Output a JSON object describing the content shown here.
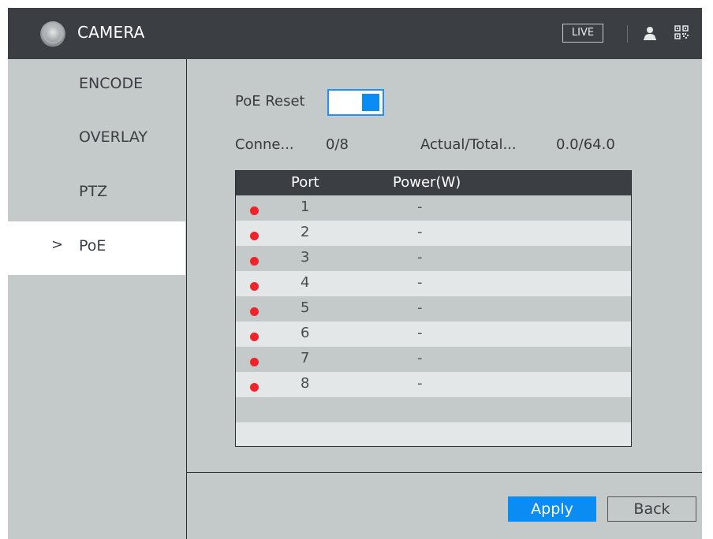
{
  "header": {
    "title": "CAMERA",
    "live_label": "LIVE",
    "icons": [
      "camera-logo-icon",
      "user-icon",
      "qr-code-icon"
    ]
  },
  "sidebar": {
    "items": [
      {
        "label": "ENCODE",
        "active": false
      },
      {
        "label": "OVERLAY",
        "active": false
      },
      {
        "label": "PTZ",
        "active": false
      },
      {
        "label": "PoE",
        "active": true,
        "chevron": ">"
      }
    ]
  },
  "poe": {
    "reset_label": "PoE Reset",
    "reset_enabled": true,
    "connected_label": "Conne...",
    "connected_value": "0/8",
    "actual_total_label": "Actual/Total...",
    "actual_total_value": "0.0/64.0"
  },
  "table": {
    "headers": {
      "port": "Port",
      "power": "Power(W)"
    },
    "rows": [
      {
        "port": "1",
        "power": "-",
        "status": "offline"
      },
      {
        "port": "2",
        "power": "-",
        "status": "offline"
      },
      {
        "port": "3",
        "power": "-",
        "status": "offline"
      },
      {
        "port": "4",
        "power": "-",
        "status": "offline"
      },
      {
        "port": "5",
        "power": "-",
        "status": "offline"
      },
      {
        "port": "6",
        "power": "-",
        "status": "offline"
      },
      {
        "port": "7",
        "power": "-",
        "status": "offline"
      },
      {
        "port": "8",
        "power": "-",
        "status": "offline"
      }
    ]
  },
  "footer": {
    "apply_label": "Apply",
    "back_label": "Back"
  },
  "colors": {
    "accent": "#0b8cf2",
    "status_offline": "#f0232a",
    "header_bg": "#3b3f44",
    "panel_bg": "#c4c9c9"
  }
}
